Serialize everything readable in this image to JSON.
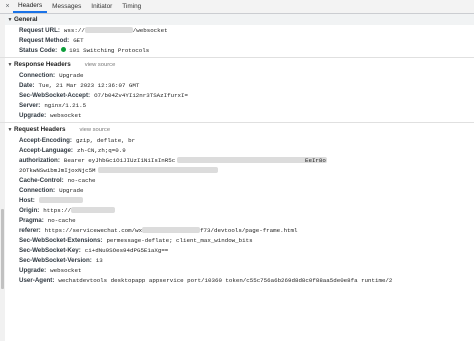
{
  "tabs": {
    "close": "×",
    "items": [
      "Headers",
      "Messages",
      "Initiator",
      "Timing"
    ]
  },
  "general": {
    "title": "General",
    "rows": [
      {
        "k": "Request URL:",
        "v1": "wss://",
        "v2": "/websocket"
      },
      {
        "k": "Request Method:",
        "v": "GET"
      },
      {
        "k": "Status Code:",
        "v": "101 Switching Protocols"
      }
    ]
  },
  "response": {
    "title": "Response Headers",
    "view_source": "view source",
    "rows": [
      {
        "k": "Connection:",
        "v": "Upgrade"
      },
      {
        "k": "Date:",
        "v": "Tue, 21 Mar 2023 12:36:07 GMT"
      },
      {
        "k": "Sec-WebSocket-Accept:",
        "v": "O7/b04Zv4YIi2nr3TSAzIfurxI="
      },
      {
        "k": "Server:",
        "v": "nginx/1.21.5"
      },
      {
        "k": "Upgrade:",
        "v": "websocket"
      }
    ]
  },
  "request": {
    "title": "Request Headers",
    "view_source": "view source",
    "accept_encoding": {
      "k": "Accept-Encoding:",
      "v": "gzip, deflate, br"
    },
    "accept_language": {
      "k": "Accept-Language:",
      "v": "zh-CN,zh;q=0.9"
    },
    "authorization": {
      "k": "authorization:",
      "v": "Bearer eyJhbGciOiJIUzI1NiIsInR5c",
      "tail": "EeIr8o",
      "line2": "2OTkwNSwibmJmIjoxNjc5M"
    },
    "cache_control": {
      "k": "Cache-Control:",
      "v": "no-cache"
    },
    "connection": {
      "k": "Connection:",
      "v": "Upgrade"
    },
    "host": {
      "k": "Host:"
    },
    "origin": {
      "k": "Origin:",
      "v": "https://"
    },
    "pragma": {
      "k": "Pragma:",
      "v": "no-cache"
    },
    "referer": {
      "k": "referer:",
      "v1": "https://servicewechat.com/wx",
      "v2": "f73/devtools/page-frame.html"
    },
    "extensions": {
      "k": "Sec-WebSocket-Extensions:",
      "v": "permessage-deflate; client_max_window_bits"
    },
    "key": {
      "k": "Sec-WebSocket-Key:",
      "v": "ci+dNu9SOes94dPG5E1aXg=="
    },
    "version": {
      "k": "Sec-WebSocket-Version:",
      "v": "13"
    },
    "upgrade": {
      "k": "Upgrade:",
      "v": "websocket"
    },
    "user_agent": {
      "k": "User-Agent:",
      "v": "wechatdevtools desktopapp appservice port/10360 token/c55c756a6b269d8d8c0f88aa5de0e8fa runtime/2"
    }
  },
  "colors": {
    "status_ok": "#0c9d3a",
    "tab_active": "#1a73e8"
  }
}
